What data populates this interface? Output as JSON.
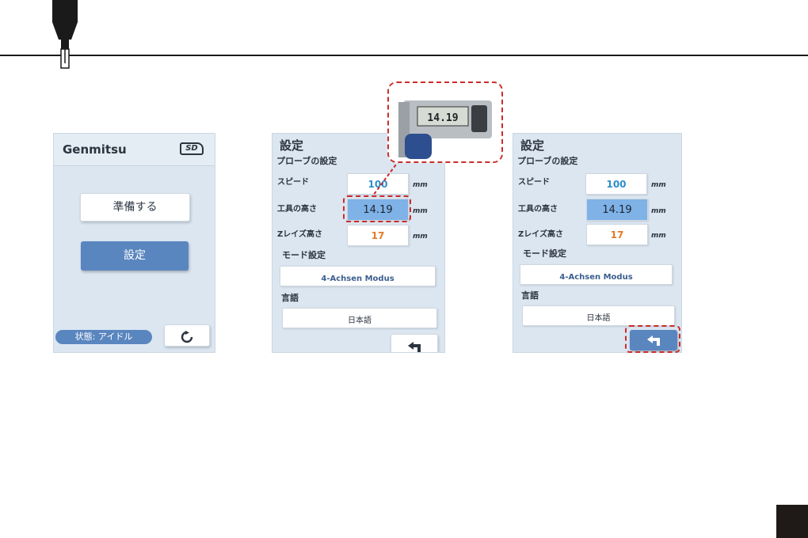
{
  "screen_login": {
    "brand": "Genmitsu",
    "sd_label": "SD",
    "prepare_label": "準備する",
    "settings_label": "設定",
    "status_label": "状態: アイドル"
  },
  "screen_settings_a": {
    "title": "設定",
    "probe_heading": "プローブの設定",
    "speed_label": "スピード",
    "speed_value": "100",
    "tool_height_label": "工具の高さ",
    "tool_height_value": "14.19",
    "z_raise_label": "Zレイズ高さ",
    "z_raise_value": "17",
    "unit": "mm",
    "mode_heading": "モード設定",
    "mode_value": "4-Achsen Modus",
    "language_heading": "言語",
    "language_value": "日本語"
  },
  "screen_settings_b": {
    "title": "設定",
    "probe_heading": "プローブの設定",
    "speed_label": "スピード",
    "speed_value": "100",
    "tool_height_label": "工具の高さ",
    "tool_height_value": "14.19",
    "z_raise_label": "Zレイズ高さ",
    "z_raise_value": "17",
    "unit": "mm",
    "mode_heading": "モード設定",
    "mode_value": "4-Achsen Modus",
    "language_heading": "言語",
    "language_value": "日本語"
  },
  "caliper_photo": {
    "readout": "14.19"
  },
  "colors": {
    "accent_blue": "#5a86bf",
    "speed_value": "#2d8ec9",
    "z_value": "#e07b2a",
    "highlight_dash": "#cc2b2b"
  },
  "icons": {
    "probe": "probe-icon",
    "sd": "sd-card-icon",
    "reset": "reset-icon",
    "back": "back-arrow-icon"
  }
}
